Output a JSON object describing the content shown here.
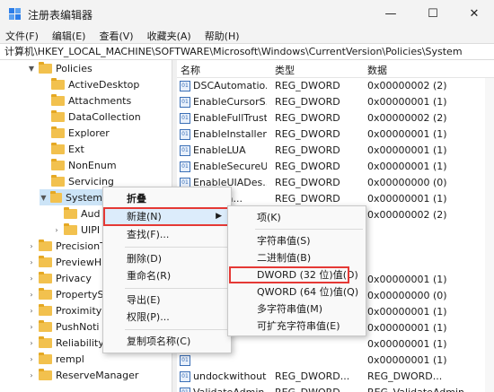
{
  "window": {
    "title": "注册表编辑器",
    "minimize_glyph": "—",
    "maximize_glyph": "☐",
    "close_glyph": "✕"
  },
  "menubar": {
    "file": "文件(F)",
    "edit": "编辑(E)",
    "view": "查看(V)",
    "favorites": "收藏夹(A)",
    "help": "帮助(H)"
  },
  "address": "计算机\\HKEY_LOCAL_MACHINE\\SOFTWARE\\Microsoft\\Windows\\CurrentVersion\\Policies\\System",
  "tree": {
    "items": [
      {
        "label": "Policies",
        "expanded": true
      },
      {
        "label": "ActiveDesktop"
      },
      {
        "label": "Attachments"
      },
      {
        "label": "DataCollection"
      },
      {
        "label": "Explorer"
      },
      {
        "label": "Ext"
      },
      {
        "label": "NonEnum"
      },
      {
        "label": "Servicing"
      },
      {
        "label": "System",
        "selected": true,
        "expanded": true
      },
      {
        "label": "Aud"
      },
      {
        "label": "UIPI"
      },
      {
        "label": "PrecisionT"
      },
      {
        "label": "PreviewH"
      },
      {
        "label": "Privacy"
      },
      {
        "label": "PropertyS"
      },
      {
        "label": "Proximity"
      },
      {
        "label": "PushNoti"
      },
      {
        "label": "Reliability"
      },
      {
        "label": "rempl"
      },
      {
        "label": "ReserveManager"
      }
    ]
  },
  "list": {
    "headers": {
      "name": "名称",
      "type": "类型",
      "data": "数据"
    },
    "rows": [
      {
        "name": "DSCAutomatio...",
        "type": "REG_DWORD",
        "data": "0x00000002 (2)"
      },
      {
        "name": "EnableCursorS...",
        "type": "REG_DWORD",
        "data": "0x00000001 (1)"
      },
      {
        "name": "EnableFullTrust...",
        "type": "REG_DWORD",
        "data": "0x00000002 (2)"
      },
      {
        "name": "EnableInstaller...",
        "type": "REG_DWORD",
        "data": "0x00000001 (1)"
      },
      {
        "name": "EnableLUA",
        "type": "REG_DWORD",
        "data": "0x00000001 (1)"
      },
      {
        "name": "EnableSecureU...",
        "type": "REG_DWORD",
        "data": "0x00000001 (1)"
      },
      {
        "name": "EnableUIADes...",
        "type": "REG_DWORD",
        "data": "0x00000000 (0)"
      },
      {
        "name": "...wpSta...",
        "type": "REG_DWORD",
        "data": "0x00000001 (1)"
      },
      {
        "name": "",
        "type": "",
        "data": "0x00000002 (2)"
      },
      {
        "name": "",
        "type": "",
        "data": ""
      },
      {
        "name": "",
        "type": "",
        "data": ""
      },
      {
        "name": "",
        "type": "",
        "data": ""
      },
      {
        "name": "",
        "type": "",
        "data": "0x00000001 (1)"
      },
      {
        "name": "",
        "type": "",
        "data": "0x00000000 (0)"
      },
      {
        "name": "",
        "type": "",
        "data": "0x00000001 (1)"
      },
      {
        "name": "",
        "type": "",
        "data": "0x00000001 (1)"
      },
      {
        "name": "",
        "type": "",
        "data": "0x00000001 (1)"
      },
      {
        "name": "",
        "type": "",
        "data": "0x00000001 (1)"
      },
      {
        "name": "undockwithout...",
        "type": "REG_DWORD...",
        "data": "REG_DWORD..."
      },
      {
        "name": "ValidateAdmin...",
        "type": "REG_DWORD...",
        "data": "REG_ValidateAdmin..."
      }
    ]
  },
  "context_menu": {
    "collapse": "折叠",
    "new": "新建(N)",
    "find": "查找(F)...",
    "delete": "删除(D)",
    "rename": "重命名(R)",
    "export": "导出(E)",
    "permissions": "权限(P)...",
    "copy_key_name": "复制项名称(C)"
  },
  "submenu": {
    "key": "项(K)",
    "string_value": "字符串值(S)",
    "binary_value": "二进制值(B)",
    "dword_value": "DWORD (32 位)值(D)",
    "qword_value": "QWORD (64 位)值(Q)",
    "multi_string_value": "多字符串值(M)",
    "expandable_string_value": "可扩充字符串值(E)"
  },
  "colors": {
    "highlight_box": "#e53935",
    "folder": "#f2c14e",
    "selection": "#cce4f7"
  }
}
